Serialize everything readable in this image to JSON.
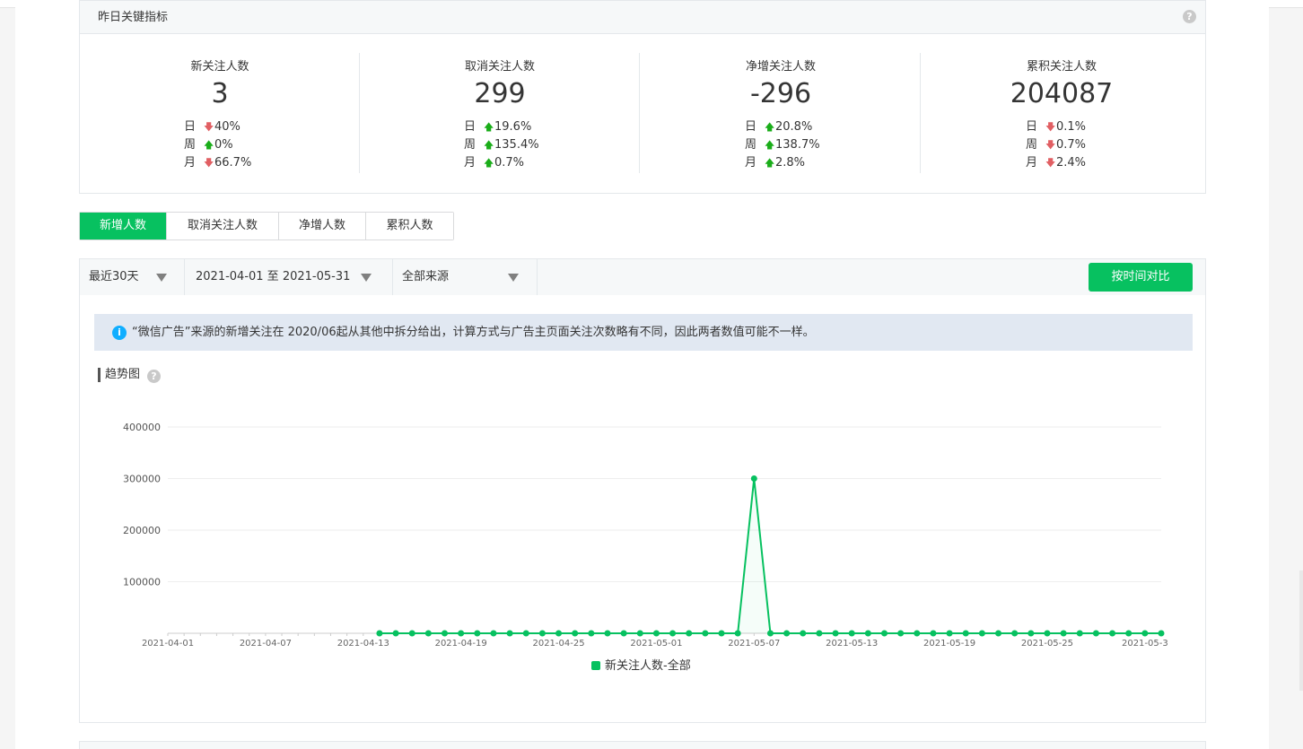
{
  "panel": {
    "title": "昨日关键指标",
    "help": "?",
    "metrics": [
      {
        "label": "新关注人数",
        "value": "3",
        "rows": [
          {
            "period": "日",
            "dir": "down",
            "pct": "40%"
          },
          {
            "period": "周",
            "dir": "up",
            "pct": "0%"
          },
          {
            "period": "月",
            "dir": "down",
            "pct": "66.7%"
          }
        ]
      },
      {
        "label": "取消关注人数",
        "value": "299",
        "rows": [
          {
            "period": "日",
            "dir": "up",
            "pct": "19.6%"
          },
          {
            "period": "周",
            "dir": "up",
            "pct": "135.4%"
          },
          {
            "period": "月",
            "dir": "up",
            "pct": "0.7%"
          }
        ]
      },
      {
        "label": "净增关注人数",
        "value": "-296",
        "rows": [
          {
            "period": "日",
            "dir": "up",
            "pct": "20.8%"
          },
          {
            "period": "周",
            "dir": "up",
            "pct": "138.7%"
          },
          {
            "period": "月",
            "dir": "up",
            "pct": "2.8%"
          }
        ]
      },
      {
        "label": "累积关注人数",
        "value": "204087",
        "rows": [
          {
            "period": "日",
            "dir": "down",
            "pct": "0.1%"
          },
          {
            "period": "周",
            "dir": "down",
            "pct": "0.7%"
          },
          {
            "period": "月",
            "dir": "down",
            "pct": "2.4%"
          }
        ]
      }
    ]
  },
  "tabs": [
    {
      "label": "新增人数",
      "active": true
    },
    {
      "label": "取消关注人数",
      "active": false
    },
    {
      "label": "净增人数",
      "active": false
    },
    {
      "label": "累积人数",
      "active": false
    }
  ],
  "filters": {
    "range": "最近30天",
    "dates": "2021-04-01 至 2021-05-31",
    "source": "全部来源",
    "compare_button": "按时间对比"
  },
  "notice": "“微信广告”来源的新增关注在 2020/06起从其他中拆分给出，计算方式与广告主页面关注次数略有不同，因此两者数值可能不一样。",
  "trend_title": "趋势图",
  "colors": {
    "accent": "#07c160",
    "up": "#1aad19",
    "down": "#e15f63",
    "info": "#10aeff"
  },
  "chart_data": {
    "type": "line",
    "ylim": [
      0,
      400000
    ],
    "yticks": [
      "400000",
      "300000",
      "200000",
      "100000"
    ],
    "xtick_labels": [
      "2021-04-01",
      "2021-04-07",
      "2021-04-13",
      "2021-04-19",
      "2021-04-25",
      "2021-05-01",
      "2021-05-07",
      "2021-05-13",
      "2021-05-19",
      "2021-05-25",
      "2021-05-3"
    ],
    "series": [
      {
        "name": "新关注人数-全部",
        "start_date": "2021-04-01",
        "values": [
          null,
          null,
          null,
          null,
          null,
          null,
          null,
          null,
          null,
          null,
          null,
          null,
          null,
          0,
          0,
          0,
          0,
          0,
          0,
          0,
          0,
          0,
          0,
          0,
          0,
          0,
          0,
          0,
          0,
          0,
          0,
          0,
          0,
          0,
          0,
          0,
          300000,
          0,
          0,
          0,
          0,
          0,
          0,
          0,
          0,
          0,
          0,
          0,
          0,
          0,
          0,
          0,
          0,
          0,
          0,
          0,
          0,
          0,
          0,
          0,
          0,
          3
        ]
      }
    ]
  }
}
